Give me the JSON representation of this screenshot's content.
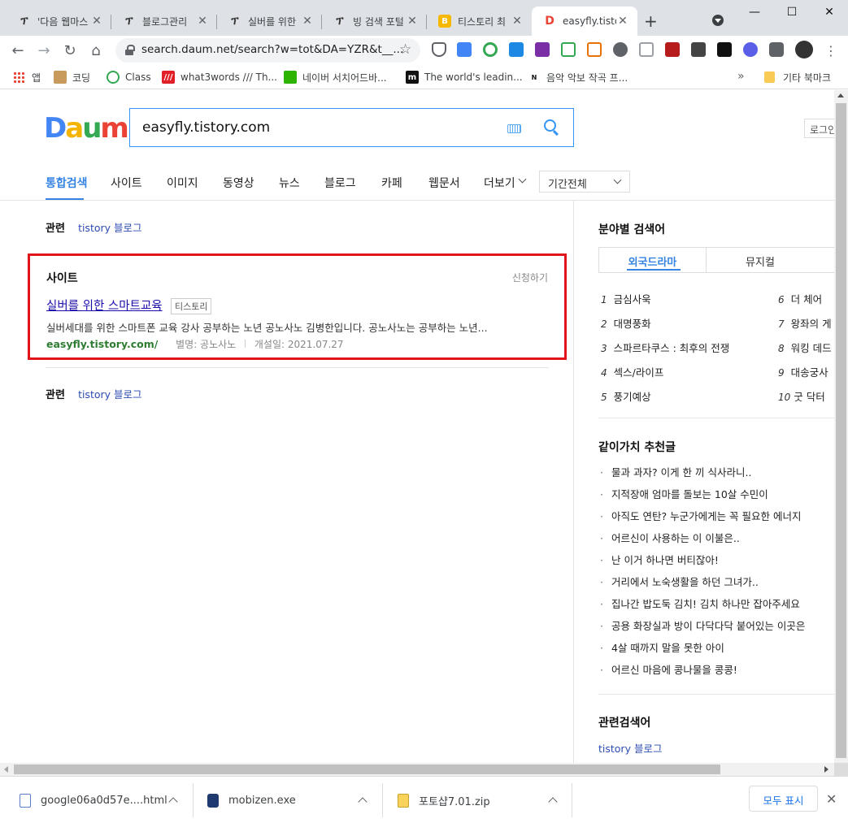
{
  "browser": {
    "tabs": [
      {
        "title": "'다음 웹마스",
        "icon": "tistory-icon"
      },
      {
        "title": "블로그관리",
        "icon": "tistory-icon"
      },
      {
        "title": "실버를 위한",
        "icon": "tistory-icon"
      },
      {
        "title": "빙 검색 포털",
        "icon": "tistory-icon"
      },
      {
        "title": "티스토리 최",
        "icon": "bookmark-b-icon"
      },
      {
        "title": "easyfly.tisto",
        "icon": "daum-icon",
        "active": true
      }
    ],
    "new_tab": "+",
    "window_controls": {
      "minimize": "—",
      "maximize": "☐",
      "close": "✕"
    },
    "url": "search.daum.net/search?w=tot&DA=YZR&t__...",
    "bookmarks": [
      {
        "label": "앱",
        "icon": "apps-icon"
      },
      {
        "label": "코딩",
        "icon": "dog-icon"
      },
      {
        "label": "Class",
        "icon": "class-icon"
      },
      {
        "label": "what3words /// Th...",
        "icon": "what3words-icon"
      },
      {
        "label": "네이버 서치어드바...",
        "icon": "naver-icon"
      },
      {
        "label": "The world's leadin...",
        "icon": "m-icon"
      },
      {
        "label": "음악 악보 작곡 프...",
        "icon": "noteflight-icon"
      }
    ],
    "bookmarks_more": "»",
    "other_bookmarks": "기타 북마크"
  },
  "daum": {
    "logo": [
      "D",
      "a",
      "u",
      "m"
    ],
    "logo_colors": [
      "#4285f4",
      "#f4b400",
      "#34a853",
      "#ea4335"
    ],
    "query": "easyfly.tistory.com",
    "login": "로그인",
    "tabs": [
      "통합검색",
      "사이트",
      "이미지",
      "동영상",
      "뉴스",
      "블로그",
      "카페",
      "웹문서",
      "더보기"
    ],
    "period": "기간전체",
    "related_label": "관련",
    "related_link": "tistory 블로그",
    "site_section": {
      "title": "사이트",
      "apply": "신청하기",
      "result_title": "실버를 위한 스마트교육",
      "badge": "티스토리",
      "description": "실버세대를 위한 스마트폰 교육 강사 공부하는 노년 공노사노 김병한입니다. 공노사노는 공부하는 노년...",
      "url": "easyfly.tistory.com/",
      "alias": "별명: 공노사노",
      "opened": "개설일: 2021.07.27"
    },
    "side": {
      "field_search_title": "분야별 검색어",
      "field_tabs": [
        "외국드라마",
        "뮤지컬"
      ],
      "ranks_left": [
        {
          "n": "1",
          "t": "금심사욱"
        },
        {
          "n": "2",
          "t": "대명풍화"
        },
        {
          "n": "3",
          "t": "스파르타쿠스 : 최후의 전쟁"
        },
        {
          "n": "4",
          "t": "섹스/라이프"
        },
        {
          "n": "5",
          "t": "풍기예상"
        }
      ],
      "ranks_right": [
        {
          "n": "6",
          "t": "더 체어"
        },
        {
          "n": "7",
          "t": "왕좌의 게"
        },
        {
          "n": "8",
          "t": "워킹 데드"
        },
        {
          "n": "9",
          "t": "대송궁사"
        },
        {
          "n": "10",
          "t": "굿 닥터"
        }
      ],
      "recommend_title": "같이가치 추천글",
      "recommend": [
        "물과 과자? 이게 한 끼 식사라니..",
        "지적장애 엄마를 돌보는 10살 수민이",
        "아직도 연탄? 누군가에게는 꼭 필요한 에너지",
        "어르신이 사용하는 이 이불은..",
        "난 이거 하나면 버티잖아!",
        "거리에서 노숙생활을 하던 그녀가..",
        "집나간 밥도둑 김치! 김치 하나만 잡아주세요",
        "공용 화장실과 방이 다닥다닥 붙어있는 이곳은",
        "4살 때까지 말을 못한 아이",
        "어르신 마음에 콩나물을 콩콩!"
      ],
      "related_search_title": "관련검색어",
      "related_search_link": "tistory 블로그"
    }
  },
  "downloads": [
    {
      "name": "google06a0d57e....html",
      "icon": "html-file-icon"
    },
    {
      "name": "mobizen.exe",
      "icon": "exe-file-icon"
    },
    {
      "name": "포토샵7.01.zip",
      "icon": "zip-file-icon"
    }
  ],
  "downloads_show_all": "모두 표시",
  "colors": {
    "accent": "#3584e4",
    "highlight_box": "#e0151b",
    "link": "#2c4bb2",
    "url_green": "#2e7d32"
  }
}
